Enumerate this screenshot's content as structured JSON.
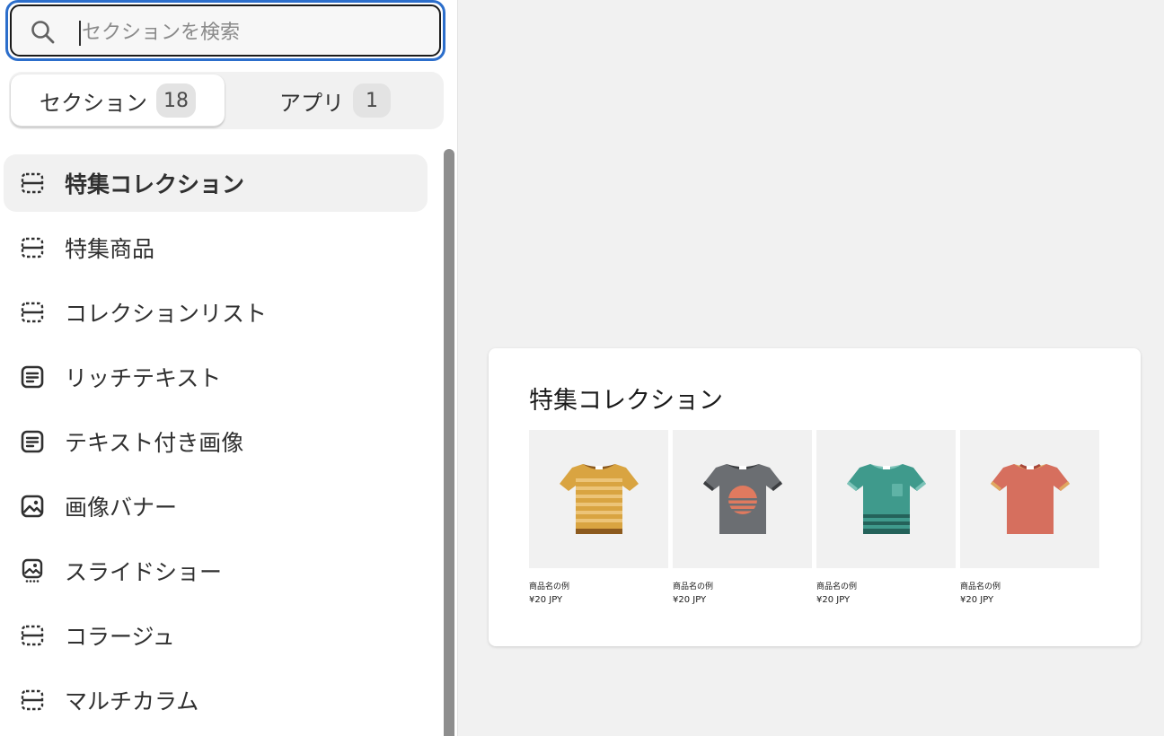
{
  "search": {
    "placeholder": "セクションを検索"
  },
  "tabs": [
    {
      "label": "セクション",
      "count": "18"
    },
    {
      "label": "アプリ",
      "count": "1"
    }
  ],
  "sections": [
    {
      "label": "特集コレクション",
      "icon": "section-placeholder-icon"
    },
    {
      "label": "特集商品",
      "icon": "section-placeholder-icon"
    },
    {
      "label": "コレクションリスト",
      "icon": "section-placeholder-icon"
    },
    {
      "label": "リッチテキスト",
      "icon": "text-block-icon"
    },
    {
      "label": "テキスト付き画像",
      "icon": "text-block-icon"
    },
    {
      "label": "画像バナー",
      "icon": "image-icon"
    },
    {
      "label": "スライドショー",
      "icon": "slideshow-icon"
    },
    {
      "label": "コラージュ",
      "icon": "section-placeholder-icon"
    },
    {
      "label": "マルチカラム",
      "icon": "section-placeholder-icon"
    }
  ],
  "preview": {
    "title": "特集コレクション",
    "products": [
      {
        "name": "商品名の例",
        "price": "¥20 JPY",
        "colors": {
          "body": "#d9a441",
          "stripe": "#ecc478",
          "collar": "#8c5a1e",
          "sleeve": "#e8b44e"
        }
      },
      {
        "name": "商品名の例",
        "price": "¥20 JPY",
        "colors": {
          "body": "#6b6e72",
          "collar": "#3c3e41",
          "sleeve": "#4a4c50",
          "graphic": "#e07a5f"
        }
      },
      {
        "name": "商品名の例",
        "price": "¥20 JPY",
        "colors": {
          "body": "#3f9a8c",
          "stripe": "#24625a",
          "collar": "#7cc3b8",
          "sleeve": "#5fb3a6"
        }
      },
      {
        "name": "商品名の例",
        "price": "¥20 JPY",
        "colors": {
          "body": "#d66f5e",
          "collar": "#a8473a",
          "sleeve": "#e0a860"
        }
      }
    ]
  },
  "colors": {
    "focus": "#2c6ecb",
    "selected_bg": "#f1f1f1",
    "canvas_bg": "#f1f1f1"
  }
}
